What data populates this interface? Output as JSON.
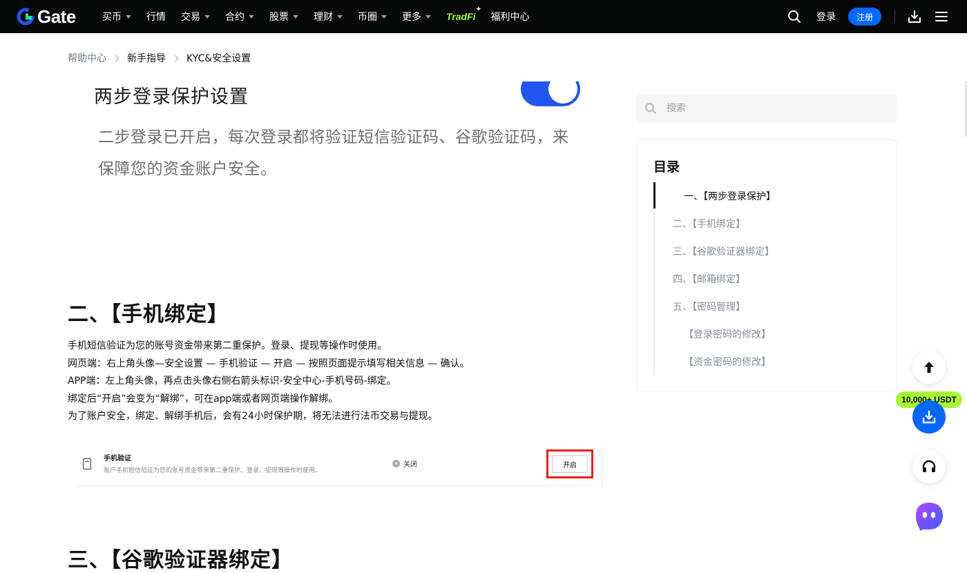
{
  "nav": {
    "logo_text": "Gate",
    "items": [
      {
        "label": "买币",
        "caret": true
      },
      {
        "label": "行情",
        "caret": false
      },
      {
        "label": "交易",
        "caret": true
      },
      {
        "label": "合约",
        "caret": true
      },
      {
        "label": "股票",
        "caret": true
      },
      {
        "label": "理财",
        "caret": true
      },
      {
        "label": "币圈",
        "caret": true
      },
      {
        "label": "更多",
        "caret": true
      }
    ],
    "tradfi_label": "TradFi",
    "welfare_label": "福利中心",
    "login_label": "登录",
    "register_label": "注册",
    "accent_color": "#0068ff",
    "tradfi_color": "#9bff2e"
  },
  "breadcrumb": [
    "帮助中心",
    "新手指导",
    "KYC&安全设置"
  ],
  "article": {
    "image_top": {
      "heading": "两步登录保护设置",
      "description": "二步登录已开启，每次登录都将验证短信验证码、谷歌验证码，来保障您的资金账户安全。"
    },
    "section2_title": "二、【手机绑定】",
    "section2_paragraphs": [
      "手机短信验证为您的账号资金带来第二重保护。登录、提现等操作时使用。",
      "网页端：右上角头像—安全设置 — 手机验证 — 开启 — 按照页面提示填写相关信息 — 确认。",
      "APP端：左上角头像，再点击头像右侧右箭头标识-安全中心-手机号码-绑定。",
      "绑定后“开启”会变为“解绑”，可在app端或者网页端操作解绑。",
      "为了账户安全，绑定、解绑手机后，会有24小时保护期，将无法进行法币交易与提现。"
    ],
    "phone_image": {
      "title": "手机验证",
      "subtitle": "账户手机短信验证为您的账号资金带来第二重保护。登录、提现等操作时使用。",
      "status": "关闭",
      "button": "开启"
    },
    "section3_title": "三、【谷歌验证器绑定】"
  },
  "sidebar": {
    "search_placeholder": "搜索",
    "toc_title": "目录",
    "toc_items": [
      {
        "label": "一、【两步登录保护】",
        "level": "active"
      },
      {
        "label": "二、【手机绑定】",
        "level": "lvl1"
      },
      {
        "label": "三、【谷歌验证器绑定】",
        "level": "lvl1"
      },
      {
        "label": "四、【邮箱绑定】",
        "level": "lvl1"
      },
      {
        "label": "五、【密码管理】",
        "level": "lvl1"
      },
      {
        "label": "【登录密码的修改】",
        "level": "lvl2"
      },
      {
        "label": "【资金密码的修改】",
        "level": "lvl2"
      }
    ]
  },
  "floating": {
    "promo_badge": "10,000+ USDT",
    "icons": [
      "arrow-up-icon",
      "download-icon",
      "headset-icon",
      "chatbot-icon"
    ]
  }
}
